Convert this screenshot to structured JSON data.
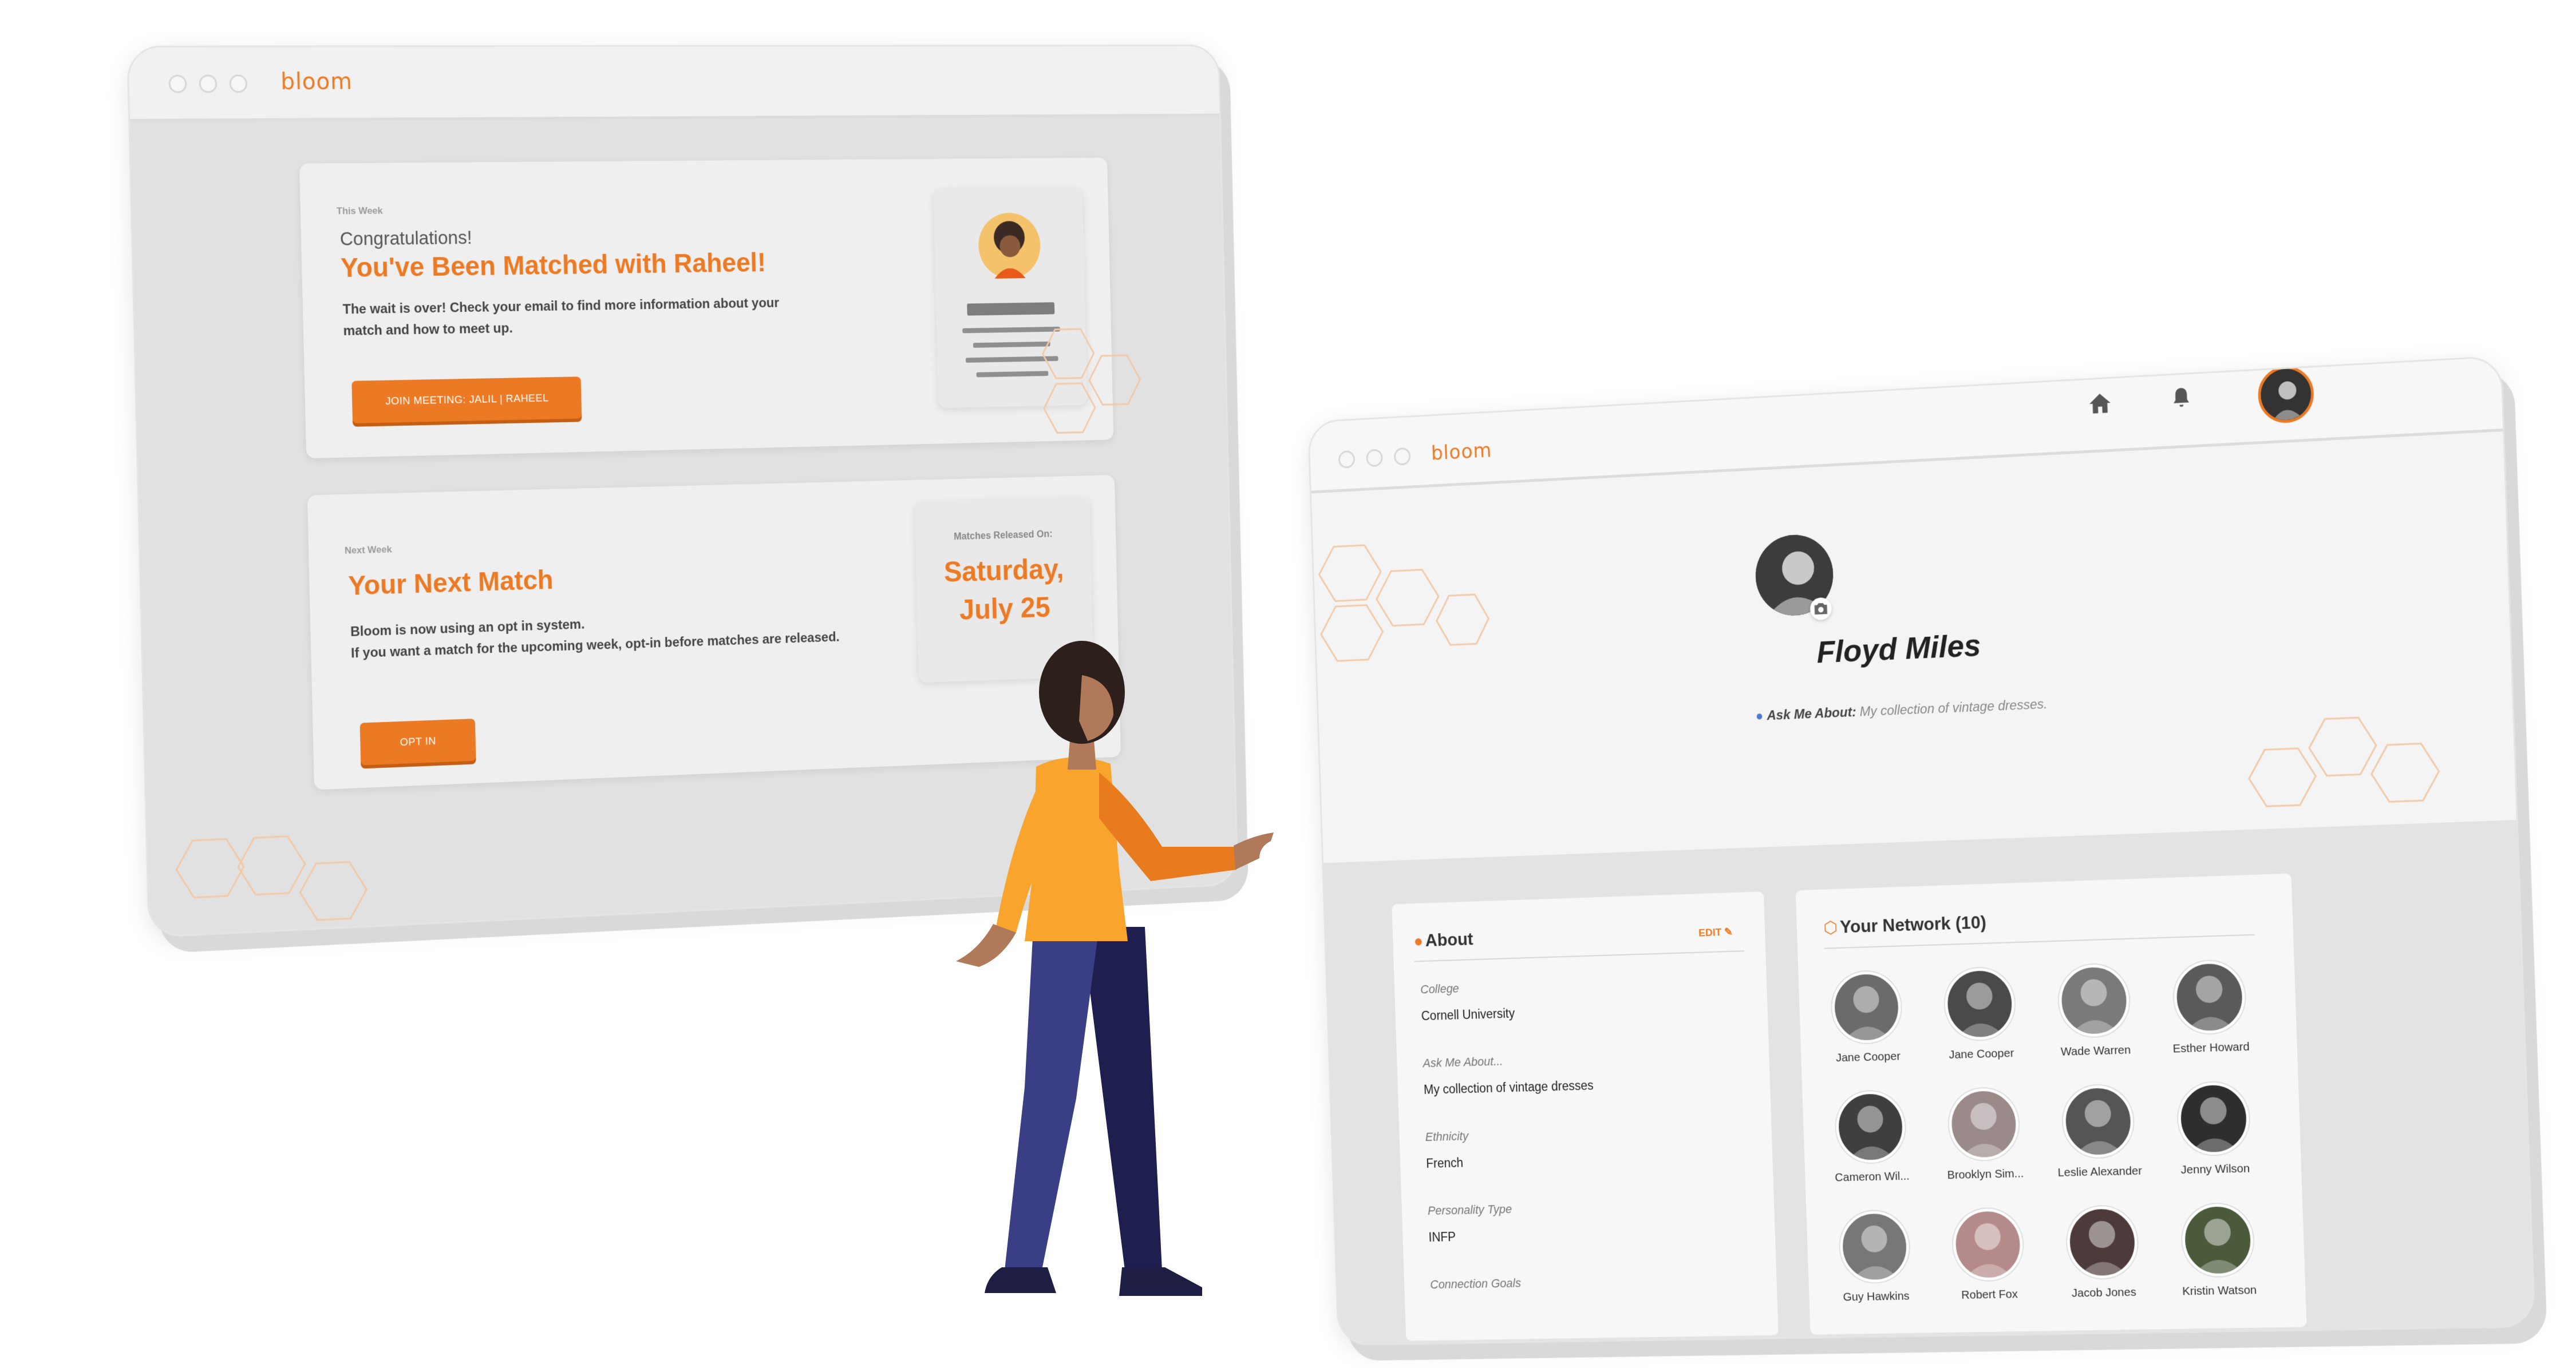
{
  "left_window": {
    "brand": "bloom",
    "this_week": {
      "label": "This Week",
      "congrats": "Congratulations!",
      "headline": "You've Been Matched with Raheel!",
      "body": "The wait is over! Check your email to find more information about your match and how to meet up.",
      "button": "JOIN MEETING: JALIL | RAHEEL"
    },
    "next_week": {
      "label": "Next Week",
      "headline": "Your Next Match",
      "body_line1": "Bloom is now using an opt in system.",
      "body_line2": "If you want a match for the upcoming week, opt-in before matches are released.",
      "button": "OPT IN",
      "release_label": "Matches Released On:",
      "release_day": "Saturday,",
      "release_date": "July 25"
    }
  },
  "right_window": {
    "brand": "bloom",
    "nav": {
      "home_icon": "home-icon",
      "bell_icon": "bell-icon",
      "avatar_icon": "user-avatar"
    },
    "profile": {
      "name": "Floyd Miles",
      "ask_me_label": "Ask Me About:",
      "ask_me_value": "My collection of vintage dresses."
    },
    "about": {
      "title": "About",
      "edit": "EDIT",
      "fields": [
        {
          "label": "College",
          "value": "Cornell University"
        },
        {
          "label": "Ask Me About...",
          "value": "My collection of vintage dresses"
        },
        {
          "label": "Ethnicity",
          "value": "French"
        },
        {
          "label": "Personality Type",
          "value": "INFP"
        },
        {
          "label": "Connection Goals",
          "value": ""
        }
      ]
    },
    "network": {
      "title": "Your Network (10)",
      "people": [
        "Jane Cooper",
        "Jane Cooper",
        "Wade Warren",
        "Esther Howard",
        "Cameron Wil...",
        "Brooklyn Sim...",
        "Leslie Alexander",
        "Jenny Wilson",
        "Guy Hawkins",
        "Robert Fox",
        "Jacob Jones",
        "Kristin Watson"
      ]
    }
  },
  "colors": {
    "accent": "#ec7a24",
    "navy": "#3a3f85",
    "yellow": "#f9a52d"
  }
}
